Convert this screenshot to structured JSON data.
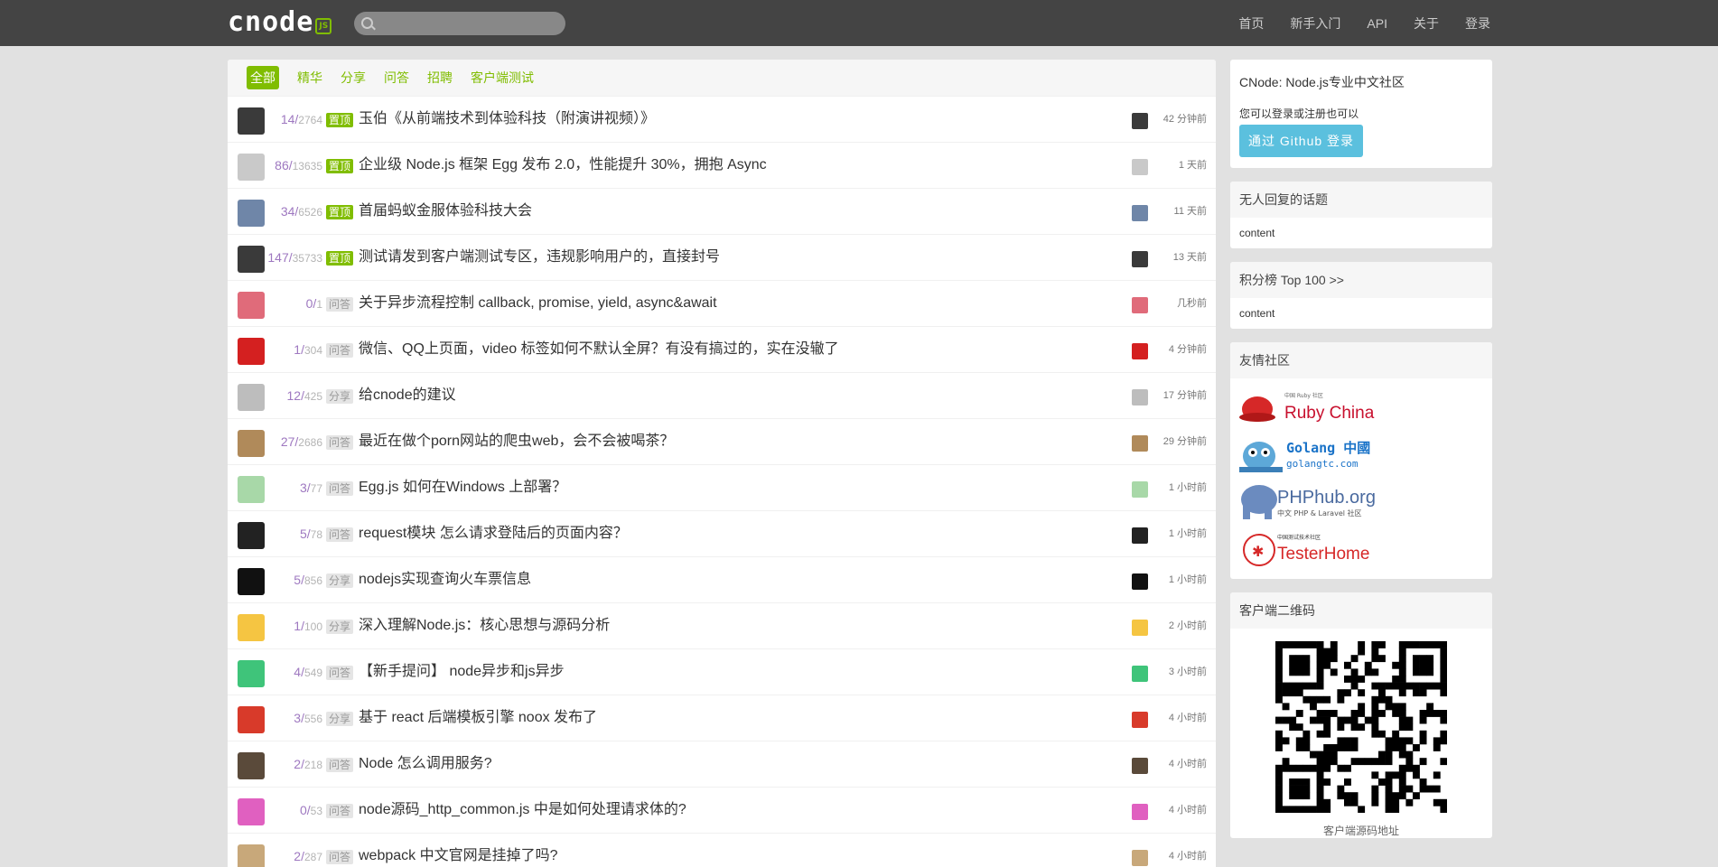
{
  "nav": {
    "logo_text": "cnode",
    "logo_badge": "JS",
    "search_placeholder": "",
    "links": [
      "首页",
      "新手入门",
      "API",
      "关于",
      "登录"
    ]
  },
  "tabs": [
    "全部",
    "精华",
    "分享",
    "问答",
    "招聘",
    "客户端测试"
  ],
  "topics": [
    {
      "replies": "14",
      "views": "2764",
      "tag": "置顶",
      "pinned": true,
      "title": "玉伯《从前端技术到体验科技（附演讲视频）》",
      "time": "42 分钟前",
      "avatar_color": "#3a3a3a"
    },
    {
      "replies": "86",
      "views": "13635",
      "tag": "置顶",
      "pinned": true,
      "title": "企业级 Node.js 框架 Egg 发布 2.0，性能提升 30%，拥抱 Async",
      "time": "1 天前",
      "avatar_color": "#c9c9c9"
    },
    {
      "replies": "34",
      "views": "6526",
      "tag": "置顶",
      "pinned": true,
      "title": "首届蚂蚁金服体验科技大会",
      "time": "11 天前",
      "avatar_color": "#6f86a8"
    },
    {
      "replies": "147",
      "views": "35733",
      "tag": "置顶",
      "pinned": true,
      "title": "测试请发到客户端测试专区，违规影响用户的，直接封号",
      "time": "13 天前",
      "avatar_color": "#3a3a3a"
    },
    {
      "replies": "0",
      "views": "1",
      "tag": "问答",
      "pinned": false,
      "title": "关于异步流程控制 callback, promise, yield, async&await",
      "time": "几秒前",
      "avatar_color": "#e06b7a"
    },
    {
      "replies": "1",
      "views": "304",
      "tag": "问答",
      "pinned": false,
      "title": "微信、QQ上页面，video 标签如何不默认全屏？有没有搞过的，实在没辙了",
      "time": "4 分钟前",
      "avatar_color": "#d42020"
    },
    {
      "replies": "12",
      "views": "425",
      "tag": "分享",
      "pinned": false,
      "title": "给cnode的建议",
      "time": "17 分钟前",
      "avatar_color": "#bdbdbd"
    },
    {
      "replies": "27",
      "views": "2686",
      "tag": "问答",
      "pinned": false,
      "title": "最近在做个porn网站的爬虫web，会不会被喝茶？",
      "time": "29 分钟前",
      "avatar_color": "#b08a5a"
    },
    {
      "replies": "3",
      "views": "77",
      "tag": "问答",
      "pinned": false,
      "title": "Egg.js 如何在Windows 上部署？",
      "time": "1 小时前",
      "avatar_color": "#a8d8a8"
    },
    {
      "replies": "5",
      "views": "78",
      "tag": "问答",
      "pinned": false,
      "title": "request模块 怎么请求登陆后的页面内容？",
      "time": "1 小时前",
      "avatar_color": "#222222"
    },
    {
      "replies": "5",
      "views": "856",
      "tag": "分享",
      "pinned": false,
      "title": "nodejs实现查询火车票信息",
      "time": "1 小时前",
      "avatar_color": "#111111"
    },
    {
      "replies": "1",
      "views": "100",
      "tag": "分享",
      "pinned": false,
      "title": "深入理解Node.js：核心思想与源码分析",
      "time": "2 小时前",
      "avatar_color": "#f5c542"
    },
    {
      "replies": "4",
      "views": "549",
      "tag": "问答",
      "pinned": false,
      "title": "【新手提问】 node异步和js异步",
      "time": "3 小时前",
      "avatar_color": "#3fc47a"
    },
    {
      "replies": "3",
      "views": "556",
      "tag": "分享",
      "pinned": false,
      "title": "基于 react 后端模板引擎 noox 发布了",
      "time": "4 小时前",
      "avatar_color": "#d83a2a"
    },
    {
      "replies": "2",
      "views": "218",
      "tag": "问答",
      "pinned": false,
      "title": "Node 怎么调用服务?",
      "time": "4 小时前",
      "avatar_color": "#5a4a3a"
    },
    {
      "replies": "0",
      "views": "53",
      "tag": "问答",
      "pinned": false,
      "title": "node源码_http_common.js 中是如何处理请求体的?",
      "time": "4 小时前",
      "avatar_color": "#e060c0"
    },
    {
      "replies": "2",
      "views": "287",
      "tag": "问答",
      "pinned": false,
      "title": "webpack 中文官网是挂掉了吗?",
      "time": "4 小时前",
      "avatar_color": "#c8a87a"
    }
  ],
  "sidebar": {
    "intro_title": "CNode: Node.js专业中文社区",
    "intro_pre": "您可以",
    "intro_login": "登录",
    "intro_or": "或",
    "intro_register": "注册",
    "intro_post": "也可以",
    "github_btn": "通过 Github 登录",
    "no_reply_title": "无人回复的话题",
    "no_reply_content": "content",
    "top100_title": "积分榜 Top 100 >>",
    "top100_content": "content",
    "friends_title": "友情社区",
    "friends": [
      {
        "name": "Ruby China",
        "sub": "中国 Ruby 社区"
      },
      {
        "name": "Golang 中國",
        "sub": "golangtc.com"
      },
      {
        "name": "PHPhub.org",
        "sub": "中文 PHP & Laravel 社区"
      },
      {
        "name": "TesterHome",
        "sub": "中国测试技术社区"
      }
    ],
    "qr_title": "客户端二维码",
    "qr_caption": "客户端源码地址"
  }
}
